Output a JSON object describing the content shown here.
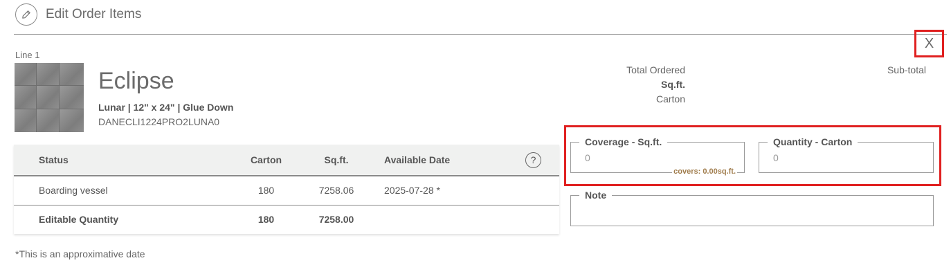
{
  "header": {
    "title": "Edit Order Items",
    "icon": "pencil-icon"
  },
  "close": {
    "label": "X"
  },
  "line": {
    "label": "Line 1"
  },
  "product": {
    "name": "Eclipse",
    "spec": "Lunar | 12\" x 24\" | Glue Down",
    "sku": "DANECLI1224PRO2LUNA0"
  },
  "table": {
    "headers": {
      "status": "Status",
      "carton": "Carton",
      "sqft": "Sq.ft.",
      "date": "Available Date",
      "help": "?"
    },
    "rows": [
      {
        "status": "Boarding vessel",
        "carton": "180",
        "sqft": "7258.06",
        "date": "2025-07-28 *"
      },
      {
        "status": "Editable Quantity",
        "carton": "180",
        "sqft": "7258.00",
        "date": ""
      }
    ]
  },
  "footnote": "*This is an approximative date",
  "totals": {
    "ordered": "Total Ordered",
    "sqft": "Sq.ft.",
    "carton": "Carton",
    "subtotal": "Sub-total"
  },
  "fields": {
    "coverage": {
      "legend": "Coverage - Sq.ft.",
      "value": "0",
      "covers": "covers: 0.00sq.ft."
    },
    "quantity": {
      "legend": "Quantity - Carton",
      "value": "0"
    },
    "note": {
      "legend": "Note",
      "value": ""
    }
  },
  "colors": {
    "highlight": "#e02020",
    "covers_text": "#a07c4c",
    "table_header_bg": "#f0f1f0"
  }
}
